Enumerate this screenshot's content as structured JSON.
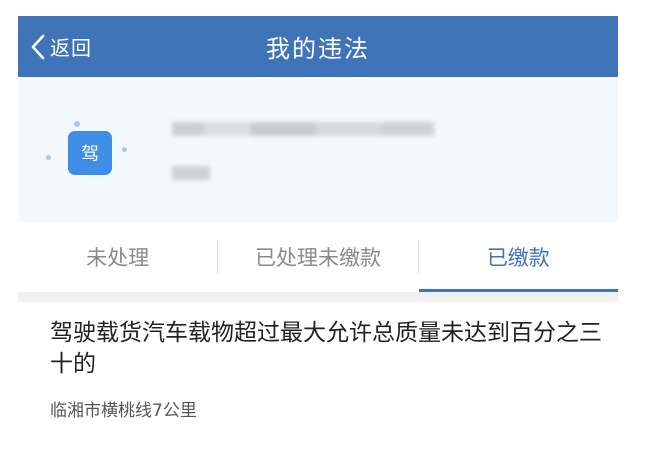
{
  "header": {
    "back_label": "返回",
    "title": "我的违法",
    "bg_color": "#3f74b9"
  },
  "profile": {
    "avatar_char": "驾",
    "avatar_icon": "driver-badge-icon"
  },
  "tabs": [
    {
      "label": "未处理",
      "active": false
    },
    {
      "label": "已处理未缴款",
      "active": false
    },
    {
      "label": "已缴款",
      "active": true
    }
  ],
  "records": [
    {
      "title": "驾驶载货汽车载物超过最大允许总质量未达到百分之三十的",
      "location": "临湘市横桃线7公里"
    }
  ],
  "colors": {
    "accent": "#3f74b9",
    "avatar_tile": "#3e8ee6",
    "profile_bg": "#f3f8fd"
  }
}
